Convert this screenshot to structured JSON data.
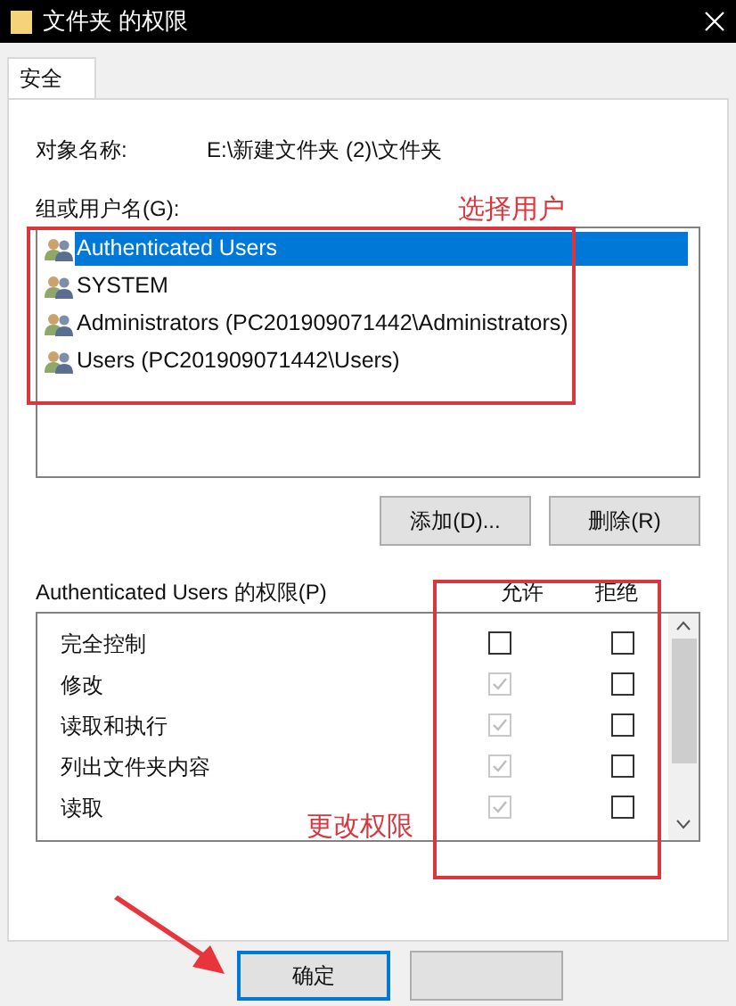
{
  "window": {
    "title": "文件夹 的权限"
  },
  "tabs": [
    {
      "label": "安全",
      "selected": true
    }
  ],
  "object_name": {
    "label": "对象名称:",
    "value": "E:\\新建文件夹 (2)\\文件夹"
  },
  "group_label": "组或用户名(G):",
  "users": [
    {
      "name": "Authenticated Users",
      "selected": true
    },
    {
      "name": "SYSTEM",
      "selected": false
    },
    {
      "name": "Administrators (PC201909071442\\Administrators)",
      "selected": false
    },
    {
      "name": "Users (PC201909071442\\Users)",
      "selected": false
    }
  ],
  "user_buttons": [
    "添加(D)...",
    "删除(R)"
  ],
  "permissions": {
    "label": "Authenticated Users 的权限(P)",
    "allow_header": "允许",
    "deny_header": "拒绝",
    "rows": [
      {
        "name": "完全控制",
        "allow": {
          "checked": false,
          "disabled": false
        },
        "deny": {
          "checked": false,
          "disabled": false
        }
      },
      {
        "name": "修改",
        "allow": {
          "checked": true,
          "disabled": true
        },
        "deny": {
          "checked": false,
          "disabled": false
        }
      },
      {
        "name": "读取和执行",
        "allow": {
          "checked": true,
          "disabled": true
        },
        "deny": {
          "checked": false,
          "disabled": false
        }
      },
      {
        "name": "列出文件夹内容",
        "allow": {
          "checked": true,
          "disabled": true
        },
        "deny": {
          "checked": false,
          "disabled": false
        }
      },
      {
        "name": "读取",
        "allow": {
          "checked": true,
          "disabled": true
        },
        "deny": {
          "checked": false,
          "disabled": false
        }
      }
    ]
  },
  "annotations": [
    {
      "text": "选择用户"
    },
    {
      "text": "更改权限"
    }
  ],
  "dialog_buttons": [
    "确定"
  ]
}
